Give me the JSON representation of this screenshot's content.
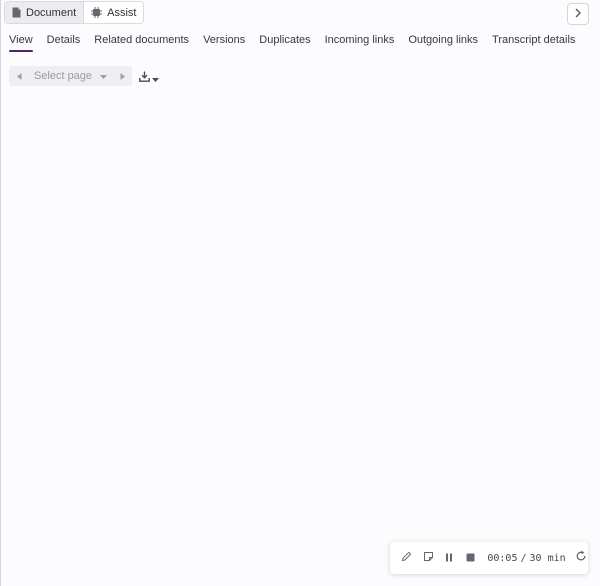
{
  "toggle": {
    "document_label": "Document",
    "assist_label": "Assist"
  },
  "tabs": [
    {
      "label": "View"
    },
    {
      "label": "Details"
    },
    {
      "label": "Related documents"
    },
    {
      "label": "Versions"
    },
    {
      "label": "Duplicates"
    },
    {
      "label": "Incoming links"
    },
    {
      "label": "Outgoing links"
    },
    {
      "label": "Transcript details"
    }
  ],
  "pager": {
    "select_label": "Select page"
  },
  "timer": {
    "elapsed": "00:05",
    "separator": "/",
    "limit": "30 min"
  },
  "icons": {
    "document": "document-icon",
    "assist": "chip-icon",
    "collapse": "chevron-right-icon",
    "prev": "caret-left-icon",
    "next": "caret-right-icon",
    "download": "download-icon",
    "pencil": "pencil-icon",
    "note": "note-icon",
    "pause": "pause-icon",
    "stop": "stop-icon",
    "refresh": "refresh-icon"
  },
  "colors": {
    "accent": "#4b2a63",
    "background": "#fcfbfd",
    "pager_bg": "#f0eef2"
  }
}
